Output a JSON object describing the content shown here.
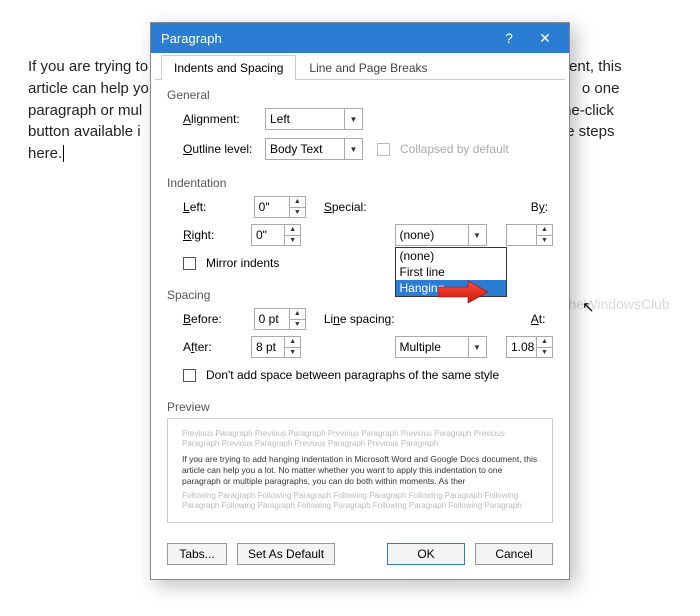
{
  "doc": {
    "line1": "If you are trying to",
    "line1r": "document, this",
    "line2": "article can help yo",
    "line2r": "o one",
    "line3": "paragraph or mul",
    "line3r": "o one-click",
    "line4": "button available i",
    "line4r": "out the steps",
    "line5": "here."
  },
  "dialog": {
    "title": "Paragraph",
    "help": "?",
    "close": "✕"
  },
  "tabs": {
    "t1": "Indents and Spacing",
    "t2": "Line and Page Breaks"
  },
  "general": {
    "title": "General",
    "alignment_label": "Alignment:",
    "alignment_value": "Left",
    "outline_label": "Outline level:",
    "outline_value": "Body Text",
    "collapsed": "Collapsed by default"
  },
  "indent": {
    "title": "Indentation",
    "left_label": "Left:",
    "left_value": "0\"",
    "right_label": "Right:",
    "right_value": "0\"",
    "special_label": "Special:",
    "special_value": "(none)",
    "by_label": "By:",
    "by_value": "",
    "mirror": "Mirror indents",
    "options": [
      "(none)",
      "First line",
      "Hanging"
    ]
  },
  "spacing": {
    "title": "Spacing",
    "before_label": "Before:",
    "before_value": "0 pt",
    "after_label": "After:",
    "after_value": "8 pt",
    "line_label": "Line spacing:",
    "line_value": "Multiple",
    "at_label": "At:",
    "at_value": "1.08",
    "noadd": "Don't add space between paragraphs of the same style"
  },
  "preview": {
    "title": "Preview",
    "ghost": "Previous Paragraph Previous Paragraph Previous Paragraph Previous Paragraph Previous Paragraph Previous Paragraph Previous Paragraph Previous Paragraph",
    "sample": "If you are trying to add hanging indentation in Microsoft Word and Google Docs document, this article can help you a lot. No matter whether you want to apply this indentation to one paragraph or multiple paragraphs, you can do both within moments. As ther",
    "ghost2": "Following Paragraph Following Paragraph Following Paragraph Following Paragraph Following Paragraph Following Paragraph Following Paragraph Following Paragraph Following Paragraph"
  },
  "buttons": {
    "tabs": "Tabs...",
    "default": "Set As Default",
    "ok": "OK",
    "cancel": "Cancel"
  },
  "watermark": "TheWindowsClub"
}
